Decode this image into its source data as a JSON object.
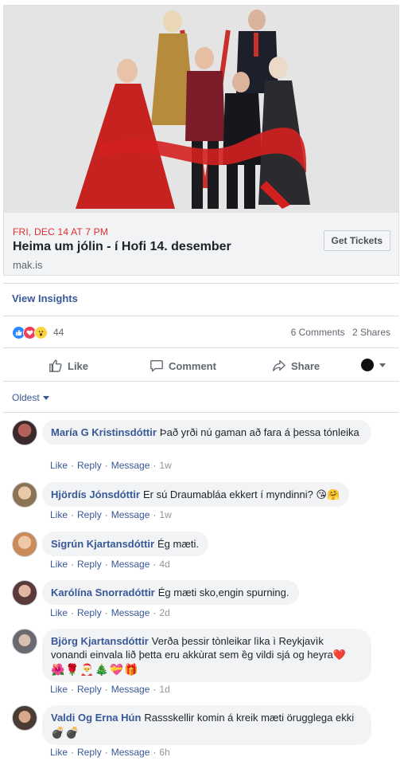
{
  "event": {
    "date": "FRI, DEC 14 AT 7 PM",
    "title": "Heima um jólin - í Hofi 14. desember",
    "domain": "mak.is",
    "tickets_label": "Get Tickets"
  },
  "insights_label": "View Insights",
  "stats": {
    "reaction_count": "44",
    "comments": "6 Comments",
    "shares": "2 Shares"
  },
  "actions": {
    "like": "Like",
    "comment": "Comment",
    "share": "Share"
  },
  "sort_label": "Oldest",
  "comment_actions": {
    "like": "Like",
    "reply": "Reply",
    "message": "Message"
  },
  "comments": [
    {
      "author": "María G Kristinsdóttir",
      "text": "Það yrði nú gaman að fara á þessa tónleika",
      "time": "1w"
    },
    {
      "author": "Hjördís Jónsdóttir",
      "text": "Er sú Draumabláa ekkert í myndinni? 😘🤗",
      "time": "1w"
    },
    {
      "author": "Sigrún Kjartansdóttir",
      "text": "Ég mæti.",
      "time": "4d"
    },
    {
      "author": "Karólína Snorradóttir",
      "text": "Ég mæti sko,engin spurning.",
      "time": "2d"
    },
    {
      "author": "Björg Kjartansdóttir",
      "text": "Verða þessir tònleikar lìka ì Reykjavìk vonandi einvala lið þetta eru akkùrat sem ȅg vildi sjá og heyra❤️",
      "emojis": "🌺🌹🎅🎄💝🎁",
      "time": "1d"
    },
    {
      "author": "Valdi Og Erna Hún",
      "text": "Rassskellir komin á kreik mæti örugglega ekki",
      "emojis": "💣💣",
      "time": "6h"
    }
  ],
  "colors": {
    "link_blue": "#385898",
    "date_red": "#e02c2c",
    "bubble_gray": "#f2f3f5"
  }
}
